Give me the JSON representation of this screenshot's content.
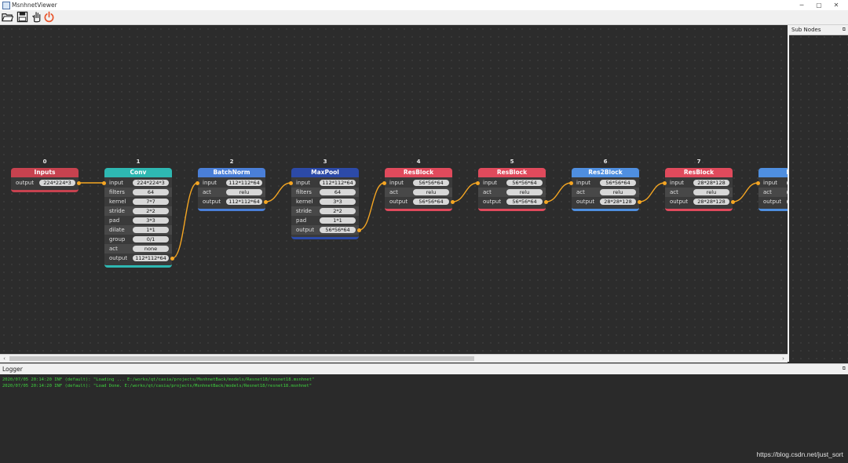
{
  "window": {
    "title": "MsnhnetViewer",
    "controls": [
      "─",
      "▢",
      "✕"
    ]
  },
  "toolbar": {
    "buttons": [
      "open-folder-icon",
      "save-image-icon",
      "hand-icon",
      "power-icon"
    ]
  },
  "colors": {
    "input_header": "#c7424f",
    "conv_header": "#2eb8b2",
    "batchnorm_header": "#4a7fd8",
    "maxpool_header": "#2c4aa8",
    "resblock_header": "#e04a5c",
    "res2block_header": "#4f8fe0",
    "port": "#f5a623",
    "edge": "#f5a623",
    "log_text": "#3fd33f"
  },
  "nodes": [
    {
      "index": "0",
      "title": "Inputs",
      "color": "#c7424f",
      "ports": [
        {
          "label": "output",
          "value": "224*224*3",
          "dot": "out"
        }
      ]
    },
    {
      "index": "1",
      "title": "Conv",
      "color": "#2eb8b2",
      "ports": [
        {
          "label": "input",
          "value": "224*224*3",
          "dot": "in"
        },
        {
          "label": "filters",
          "value": "64"
        },
        {
          "label": "kernel",
          "value": "7*7"
        },
        {
          "label": "stride",
          "value": "2*2"
        },
        {
          "label": "pad",
          "value": "3*3"
        },
        {
          "label": "dilate",
          "value": "1*1"
        },
        {
          "label": "group",
          "value": "0/1"
        },
        {
          "label": "act",
          "value": "none"
        },
        {
          "label": "output",
          "value": "112*112*64",
          "dot": "out"
        }
      ]
    },
    {
      "index": "2",
      "title": "BatchNorm",
      "color": "#4a7fd8",
      "ports": [
        {
          "label": "input",
          "value": "112*112*64",
          "dot": "in"
        },
        {
          "label": "act",
          "value": "relu"
        },
        {
          "label": "output",
          "value": "112*112*64",
          "dot": "out"
        }
      ]
    },
    {
      "index": "3",
      "title": "MaxPool",
      "color": "#2c4aa8",
      "ports": [
        {
          "label": "input",
          "value": "112*112*64",
          "dot": "in"
        },
        {
          "label": "filters",
          "value": "64"
        },
        {
          "label": "kernel",
          "value": "3*3"
        },
        {
          "label": "stride",
          "value": "2*2"
        },
        {
          "label": "pad",
          "value": "1*1"
        },
        {
          "label": "output",
          "value": "56*56*64",
          "dot": "out"
        }
      ]
    },
    {
      "index": "4",
      "title": "ResBlock",
      "color": "#e04a5c",
      "ports": [
        {
          "label": "input",
          "value": "56*56*64",
          "dot": "in"
        },
        {
          "label": "act",
          "value": "relu"
        },
        {
          "label": "output",
          "value": "56*56*64",
          "dot": "out"
        }
      ]
    },
    {
      "index": "5",
      "title": "ResBlock",
      "color": "#e04a5c",
      "ports": [
        {
          "label": "input",
          "value": "56*56*64",
          "dot": "in"
        },
        {
          "label": "act",
          "value": "relu"
        },
        {
          "label": "output",
          "value": "56*56*64",
          "dot": "out"
        }
      ]
    },
    {
      "index": "6",
      "title": "Res2Block",
      "color": "#4f8fe0",
      "ports": [
        {
          "label": "input",
          "value": "56*56*64",
          "dot": "in"
        },
        {
          "label": "act",
          "value": "relu"
        },
        {
          "label": "output",
          "value": "28*28*128",
          "dot": "out"
        }
      ]
    },
    {
      "index": "7",
      "title": "ResBlock",
      "color": "#e04a5c",
      "ports": [
        {
          "label": "input",
          "value": "28*28*128",
          "dot": "in"
        },
        {
          "label": "act",
          "value": "relu"
        },
        {
          "label": "output",
          "value": "28*28*128",
          "dot": "out"
        }
      ]
    },
    {
      "index": "",
      "title": "Res",
      "color": "#4f8fe0",
      "ports": [
        {
          "label": "input",
          "value": "",
          "dot": "in"
        },
        {
          "label": "act",
          "value": ""
        },
        {
          "label": "output",
          "value": ""
        }
      ]
    }
  ],
  "subnodes": {
    "title": "Sub Nodes",
    "float_icon": "⧉"
  },
  "logger": {
    "title": "Logger",
    "float_icon": "⧉",
    "lines": [
      "2020/07/05 20:14:20 INF (default): \"Loading ... E:/works/qt/casia/projects/MsnhnetBack/models/Resnet18/resnet18.msnhnet\"",
      "2020/07/05 20:14:20 INF (default): \"Load Done. E:/works/qt/casia/projects/MsnhnetBack/models/Resnet18/resnet18.msnhnet\""
    ]
  },
  "watermark": "https://blog.csdn.net/just_sort"
}
